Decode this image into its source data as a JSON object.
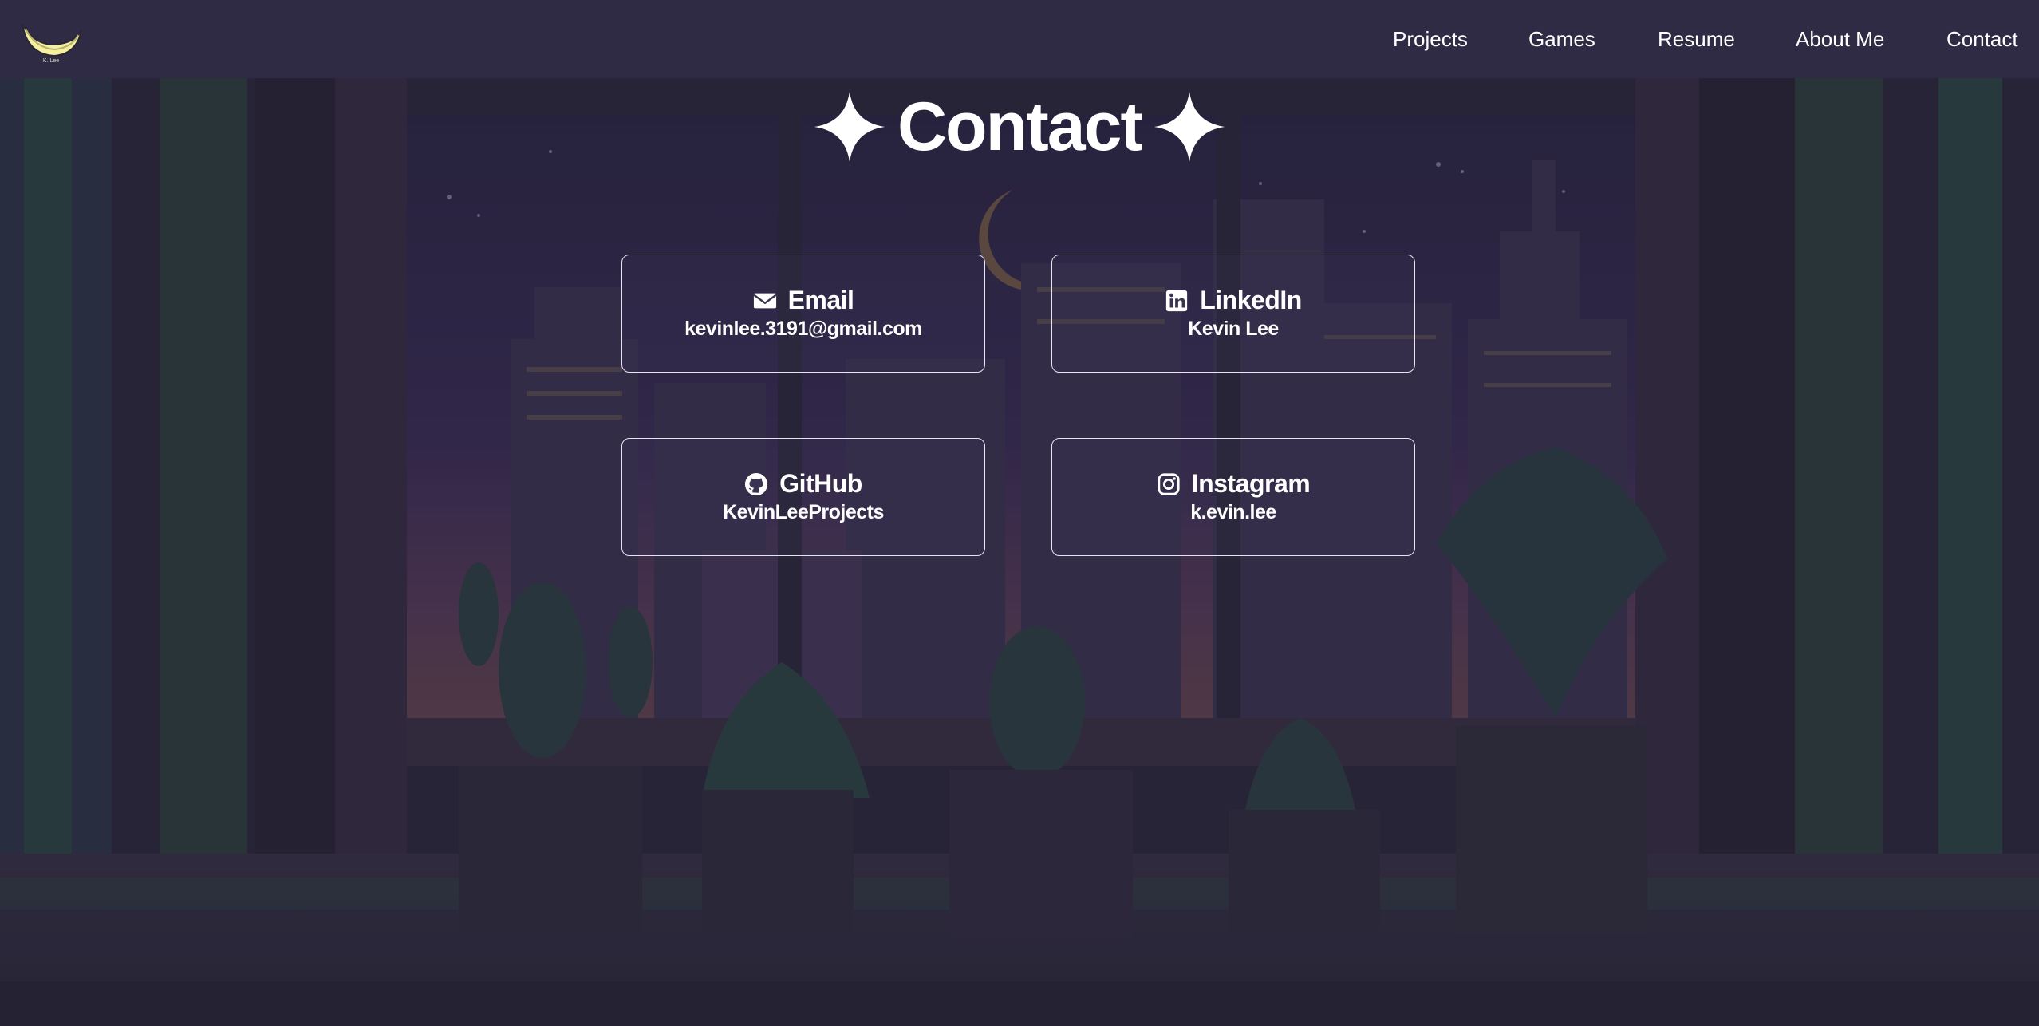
{
  "logo": {
    "caption": "K. Lee",
    "icon": "banana-moon-icon"
  },
  "nav": {
    "items": [
      {
        "label": "Projects"
      },
      {
        "label": "Games"
      },
      {
        "label": "Resume"
      },
      {
        "label": "About Me"
      },
      {
        "label": "Contact"
      }
    ]
  },
  "page": {
    "title": "Contact",
    "title_icon": "sparkle-icon"
  },
  "contacts": [
    {
      "label": "Email",
      "value": "kevinlee.3191@gmail.com",
      "icon": "envelope-icon"
    },
    {
      "label": "LinkedIn",
      "value": "Kevin Lee",
      "icon": "linkedin-icon"
    },
    {
      "label": "GitHub",
      "value": "KevinLeeProjects",
      "icon": "github-icon"
    },
    {
      "label": "Instagram",
      "value": "k.evin.lee",
      "icon": "instagram-icon"
    }
  ],
  "colors": {
    "navbar": "#2f2b44",
    "text": "#ffffff",
    "card_border": "#e6e4ee",
    "logo_yellow": "#f4f0a0"
  }
}
